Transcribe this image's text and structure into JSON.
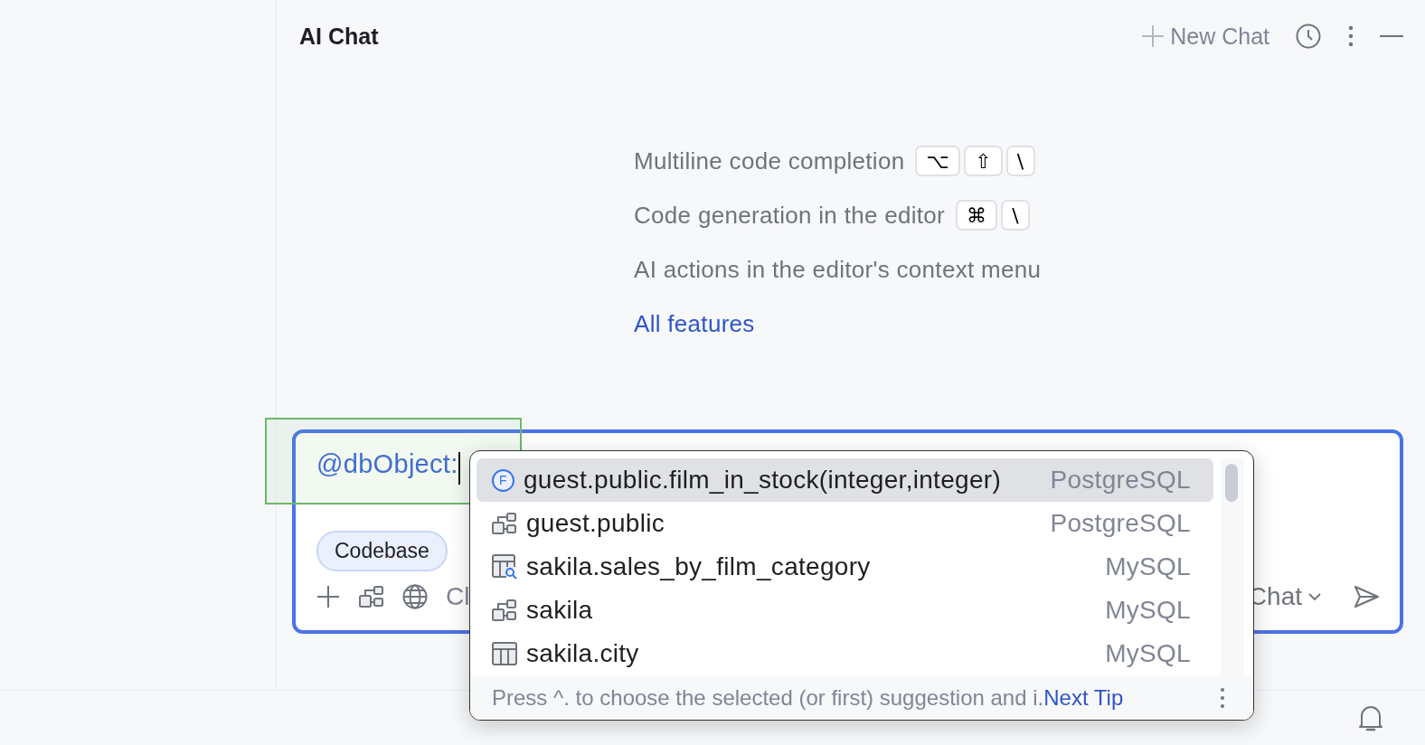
{
  "header": {
    "title": "AI Chat",
    "new_chat": "New Chat"
  },
  "tips": [
    {
      "kind": "shortcut",
      "text": "Multiline code completion",
      "keys": [
        "⌥",
        "⇧",
        "\\"
      ]
    },
    {
      "kind": "shortcut",
      "text": "Code generation in the editor",
      "keys": [
        "⌘",
        "\\"
      ]
    },
    {
      "kind": "plain",
      "text": "AI actions in the editor's context menu"
    },
    {
      "kind": "link",
      "text": "All features"
    }
  ],
  "input": {
    "value": "@dbObject:",
    "chips": [
      "Codebase"
    ],
    "toolbar_text": "Cl",
    "mode": "Chat"
  },
  "completion": {
    "items": [
      {
        "kind": "function",
        "badge": "F",
        "name": "guest.public.film_in_stock(integer,integer)",
        "source": "PostgreSQL",
        "selected": true
      },
      {
        "kind": "schema",
        "name": "guest.public",
        "source": "PostgreSQL",
        "selected": false
      },
      {
        "kind": "view",
        "name": "sakila.sales_by_film_category",
        "source": "MySQL",
        "selected": false
      },
      {
        "kind": "schema",
        "name": "sakila",
        "source": "MySQL",
        "selected": false
      },
      {
        "kind": "table",
        "name": "sakila.city",
        "source": "MySQL",
        "selected": false
      }
    ],
    "hint": "Press ^. to choose the selected (or first) suggestion and i.",
    "hint_link": "Next Tip"
  }
}
